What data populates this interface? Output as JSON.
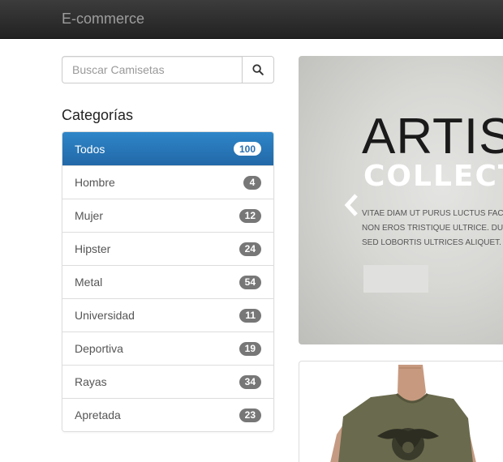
{
  "navbar": {
    "brand": "E-commerce"
  },
  "search": {
    "placeholder": "Buscar Camisetas",
    "icon": "search-icon"
  },
  "categories": {
    "title": "Categorías",
    "items": [
      {
        "label": "Todos",
        "count": "100",
        "active": true
      },
      {
        "label": "Hombre",
        "count": "4"
      },
      {
        "label": "Mujer",
        "count": "12"
      },
      {
        "label": "Hipster",
        "count": "24"
      },
      {
        "label": "Metal",
        "count": "54"
      },
      {
        "label": "Universidad",
        "count": "11"
      },
      {
        "label": "Deportiva",
        "count": "19"
      },
      {
        "label": "Rayas",
        "count": "34"
      },
      {
        "label": "Apretada",
        "count": "23"
      }
    ]
  },
  "carousel": {
    "headline": "ARTIS",
    "subheadline": "COLLECT",
    "text_lines": [
      "VITAE DIAM UT PURUS LUCTUS FACI",
      "NON EROS TRISTIQUE ULTRICE. DU",
      "SED LOBORTIS ULTRICES ALIQUET."
    ]
  },
  "colors": {
    "active": "#2a6fb0",
    "navbar": "#222222",
    "badge": "#777777"
  }
}
